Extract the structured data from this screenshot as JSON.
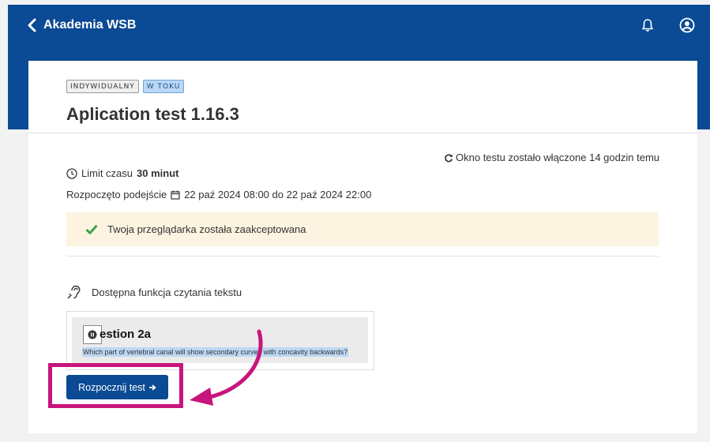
{
  "header": {
    "back_label": "Akademia WSB",
    "bell_icon": "bell-icon",
    "user_icon": "user-circle-icon",
    "color": "#0b4a94"
  },
  "test": {
    "badges": [
      "INDYWIDUALNY",
      "W TOKU"
    ],
    "title": "Aplication test 1.16.3",
    "window_info": "Okno testu zostało włączone 14 godzin temu",
    "limit_label": "Limit czasu",
    "limit_value": "30 minut",
    "started_label": "Rozpoczęto podejście",
    "started_value": "22 paź 2024 08:00 do 22 paź 2024 22:00",
    "alert_text": "Twoja przeglądarka została zaakceptowana",
    "reader_text": "Dostępna funkcja czytania tekstu",
    "preview": {
      "question_title": "estion 2a",
      "question_text": "Which part of vertebral canal will show secondary curves with concavity backwards?"
    },
    "start_button": "Rozpocznij test",
    "highlight_color": "#c7157c"
  }
}
